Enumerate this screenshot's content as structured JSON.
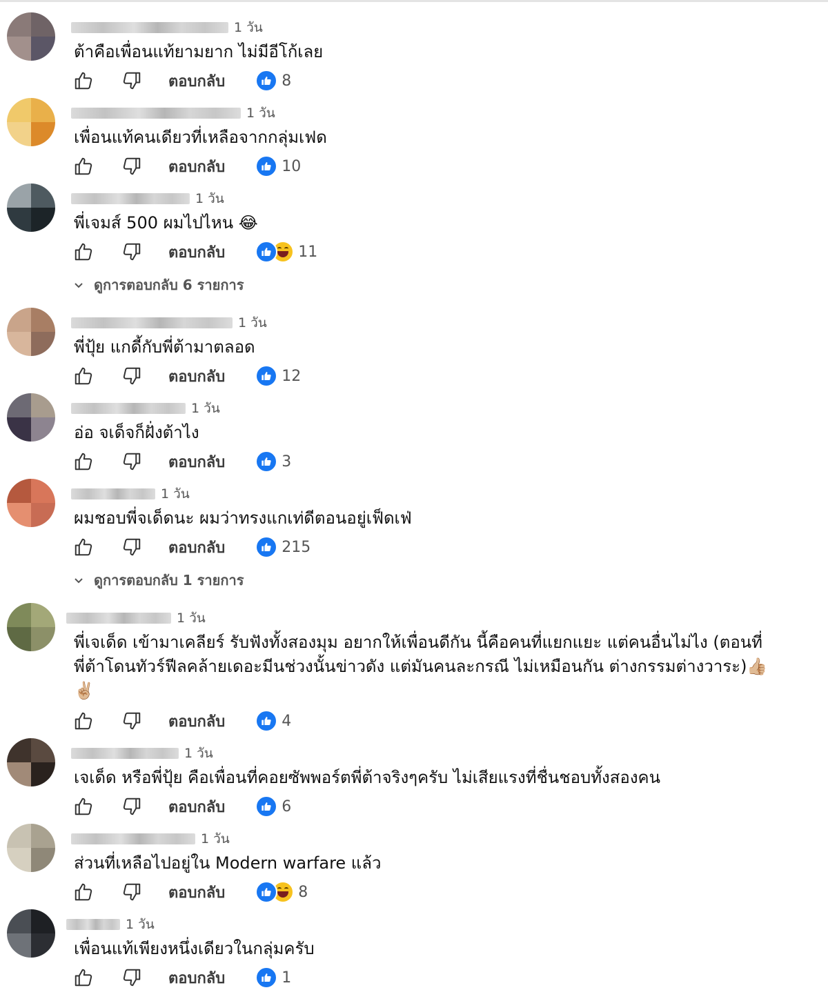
{
  "comments": [
    {
      "time": "1 วัน",
      "text": "ต้าคือเพื่อนแท้ยามยาก ไม่มีอีโก้เลย",
      "reply_label": "ตอบกลับ",
      "like_count": "8",
      "reactions": [
        "like-icon"
      ]
    },
    {
      "time": "1 วัน",
      "text": "เพื่อนแท้คนเดียวที่เหลือจากกลุ่มเฟด",
      "reply_label": "ตอบกลับ",
      "like_count": "10",
      "reactions": [
        "like-icon"
      ]
    },
    {
      "time": "1 วัน",
      "text": "พี่เจมส์ 500 ผมไปไหน 😂",
      "reply_label": "ตอบกลับ",
      "like_count": "11",
      "reactions": [
        "like-icon",
        "haha-icon"
      ],
      "view_replies": "ดูการตอบกลับ 6 รายการ"
    },
    {
      "time": "1 วัน",
      "text": "พี่ปุ้ย แกดี้กับพี่ต้ามาตลอด",
      "reply_label": "ตอบกลับ",
      "like_count": "12",
      "reactions": [
        "like-icon"
      ]
    },
    {
      "time": "1 วัน",
      "text": "อ่อ จเด็จก็ฝั่งต้าไง",
      "reply_label": "ตอบกลับ",
      "like_count": "3",
      "reactions": [
        "like-icon"
      ]
    },
    {
      "time": "1 วัน",
      "text": "ผมชอบพี่จเด็ดนะ ผมว่าทรงแกเท่ดีตอนอยู่เฟ็ดเฟ่",
      "reply_label": "ตอบกลับ",
      "like_count": "215",
      "reactions": [
        "like-icon"
      ],
      "view_replies": "ดูการตอบกลับ 1 รายการ"
    },
    {
      "time": "1 วัน",
      "text": "พี่เจเด็ด เข้ามาเคลียร์ รับฟังทั้งสองมุม อยากให้เพื่อนดีกัน นี้คือคนที่แยกแยะ แต่คนอื่นไม่ไง (ตอนที่\nพี่ต้าโดนทัวร์ฟีลคล้ายเดอะมีนช่วงนั้นข่าวดัง แต่มันคนละกรณี ไม่เหมือนกัน ต่างกรรมต่างวาระ)👍🏼\n✌🏼",
      "reply_label": "ตอบกลับ",
      "like_count": "4",
      "reactions": [
        "like-icon"
      ]
    },
    {
      "time": "1 วัน",
      "text": "เจเด็ด หรือพี่ปุ้ย คือเพื่อนที่คอยซัพพอร์ตพี่ต้าจริงๆครับ ไม่เสียแรงที่ชื่นชอบทั้งสองคน",
      "reply_label": "ตอบกลับ",
      "like_count": "6",
      "reactions": [
        "like-icon"
      ]
    },
    {
      "time": "1 วัน",
      "text": "ส่วนที่เหลือไปอยู่ใน Modern warfare แล้ว",
      "reply_label": "ตอบกลับ",
      "like_count": "8",
      "reactions": [
        "like-icon",
        "haha-icon"
      ]
    },
    {
      "time": "1 วัน",
      "text": "เพื่อนแท้เพียงหนึ่งเดียวในกลุ่มครับ",
      "reply_label": "ตอบกลับ",
      "like_count": "1",
      "reactions": [
        "like-icon"
      ]
    }
  ]
}
